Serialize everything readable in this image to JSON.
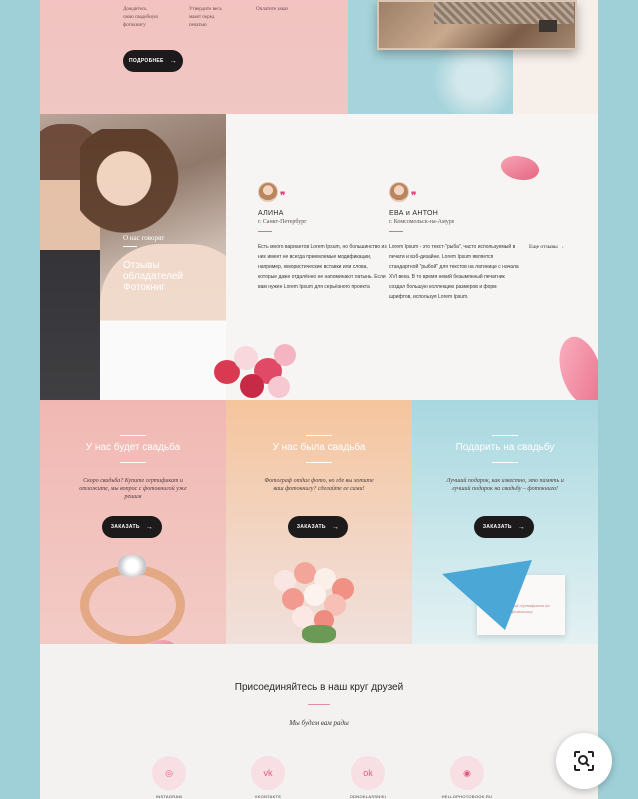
{
  "top": {
    "col1": [
      "Дождитесь",
      "свою свадебную",
      "фотокнигу"
    ],
    "col2": [
      "Утвердите весь",
      "макет перед",
      "печатью"
    ],
    "col3": [
      "Оплатите заказ"
    ],
    "button_label": "ПОДРОБНЕЕ",
    "button_arrow": "→"
  },
  "photo": {
    "small": "О нас говорят",
    "title": "Отзывы обладателей Фотокниг"
  },
  "reviews": [
    {
      "name": "АЛИНА",
      "city": "г. Санкт-Петербург",
      "quote": "❞",
      "text": "Есть много вариантов Lorem Ipsum, но большинство из них имеет не всегда приемлемые модификации, например, юмористические вставки или слова, которые даже отдалённо не напоминают латынь. Если вам нужен Lorem Ipsum для серьёзного проекта"
    },
    {
      "name": "ЕВА и АНТОН",
      "city": "г. Комсомольск-на-Амуре",
      "quote": "❞",
      "text": "Lorem Ipsum - это текст-\"рыба\", часто используемый в печати и вэб-дизайне. Lorem Ipsum является стандартной \"рыбой\" для текстов на латинице с начала XVI века. В то время некий безымянный печатник создал большую коллекцию размеров и форм шрифтов, используя Lorem Ipsum."
    }
  ],
  "more": {
    "label": "Еще отзывы",
    "chevron": "›"
  },
  "columns": [
    {
      "title": "У нас будет свадьба",
      "text": "Скоро свадьба? Купите сертификат и отложите, мы вопрос с фотокнигой уже решим",
      "button": "ЗАКАЗАТЬ",
      "arrow": "→"
    },
    {
      "title": "У нас была свадьба",
      "text": "Фотограф отдал фото, но где вы хотите ваш фотокнигу? сделайте ее сами!",
      "button": "ЗАКАЗАТЬ",
      "arrow": "→"
    },
    {
      "title": "Подарить на свадьбу",
      "text": "Лучший подарок, как известно, это память и лучший подарок на свадьбу – фотокнига!",
      "button": "ЗАКАЗАТЬ",
      "arrow": "→",
      "card_text": "Подарочный сертификат на фотокнигу"
    }
  ],
  "join": {
    "title": "Присоединяйтесь в наш круг друзей",
    "subtitle": "Мы будем вам рады",
    "socials": [
      {
        "icon": "instagram-icon",
        "glyph": "◎",
        "label": "INSTAGRAM"
      },
      {
        "icon": "vk-icon",
        "glyph": "vk",
        "label": "VKONTAKTE"
      },
      {
        "icon": "odnoklassniki-icon",
        "glyph": "ok",
        "label": "ODNOKLASSNIKI"
      },
      {
        "icon": "pinterest-icon",
        "glyph": "◉",
        "label": "HELLOPHOTOBOOK.RU"
      }
    ]
  },
  "colors": {
    "accent": "#e2457a",
    "button": "#1d1a1c",
    "teal": "#9fd0d8"
  }
}
